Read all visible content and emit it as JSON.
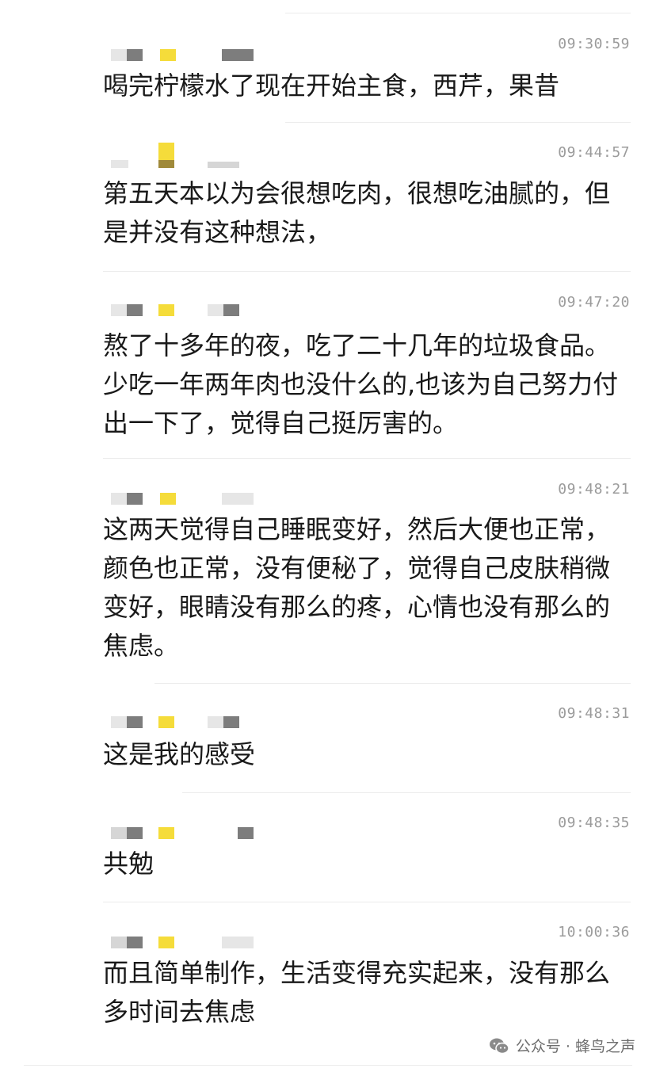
{
  "messages": [
    {
      "time": "09:30:59",
      "text": "喝完柠檬水了现在开始主食，西芹，果昔"
    },
    {
      "time": "09:44:57",
      "text": "第五天本以为会很想吃肉，很想吃油腻的，但是并没有这种想法，"
    },
    {
      "time": "09:47:20",
      "text": "熬了十多年的夜，吃了二十几年的垃圾食品。少吃一年两年肉也没什么的,也该为自己努力付出一下了，觉得自己挺厉害的。"
    },
    {
      "time": "09:48:21",
      "text": "这两天觉得自己睡眠变好，然后大便也正常，颜色也正常，没有便秘了，觉得自己皮肤稍微变好，眼睛没有那么的疼，心情也没有那么的焦虑。"
    },
    {
      "time": "09:48:31",
      "text": "这是我的感受"
    },
    {
      "time": "09:48:35",
      "text": "共勉"
    },
    {
      "time": "10:00:36",
      "text": "而且简单制作，生活变得充实起来，没有那么多时间去焦虑"
    }
  ],
  "watermark": {
    "icon": "wechat-icon",
    "text": "公众号 · 蜂鸟之声"
  }
}
